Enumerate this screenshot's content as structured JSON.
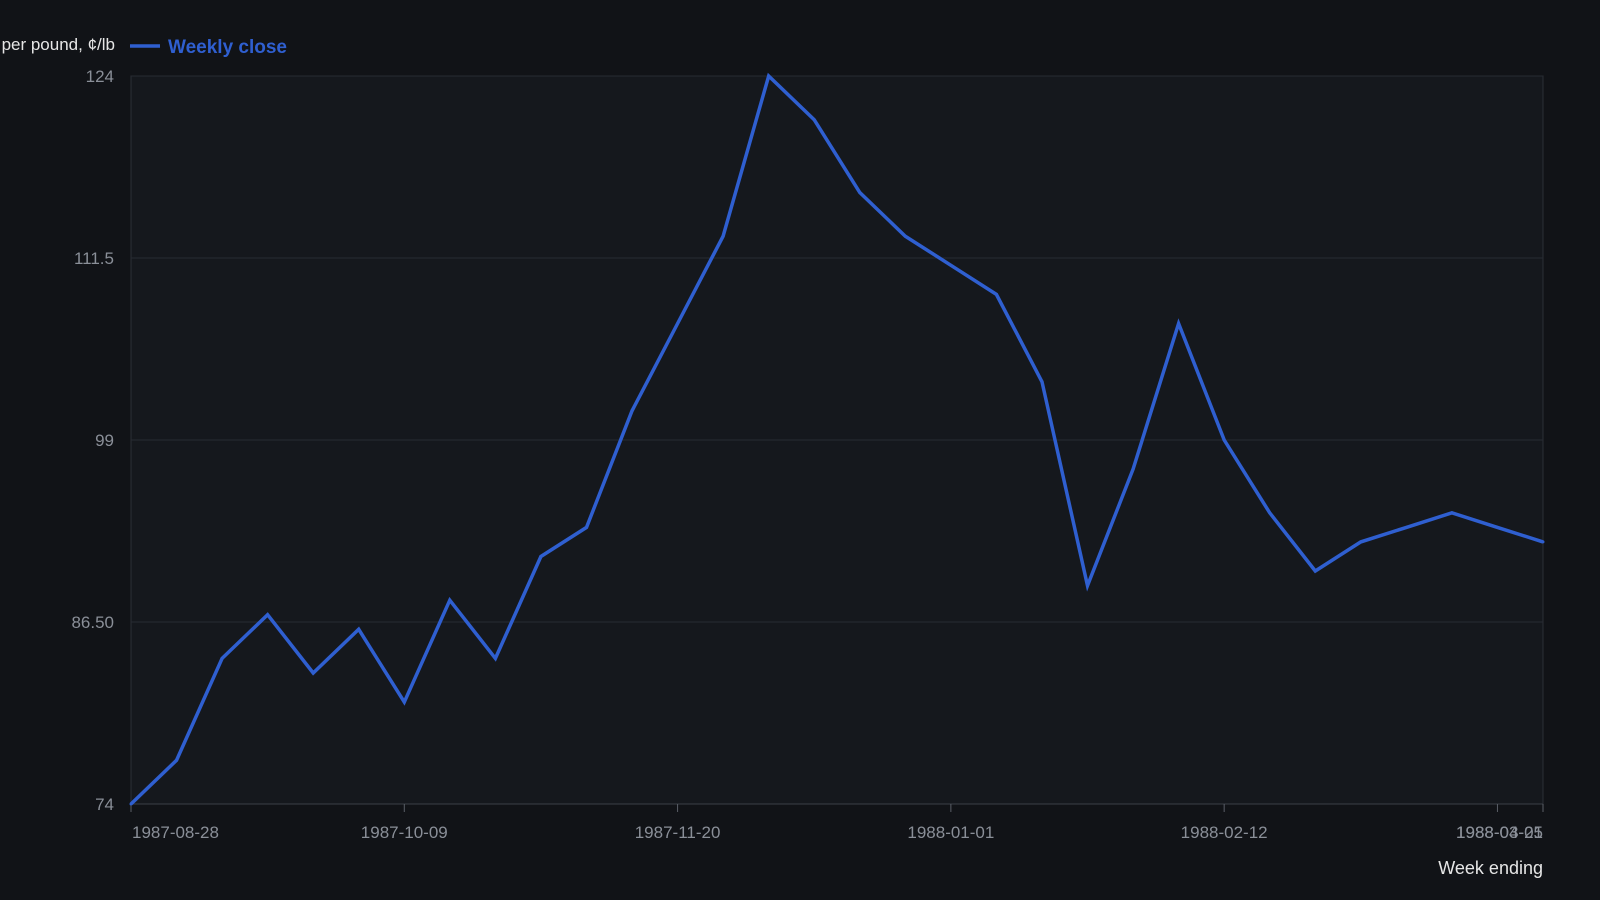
{
  "chart_data": {
    "type": "line",
    "ylabel": "Price per pound, ¢/lb",
    "xlabel": "Week ending",
    "ylim": [
      74,
      124
    ],
    "yticks": [
      "74",
      "86.50",
      "99",
      "111.5",
      "124"
    ],
    "xticks": [
      "1987-08-28",
      "1987-10-09",
      "1987-11-20",
      "1988-01-01",
      "1988-02-12",
      "1988-03-25",
      "1988-04-01"
    ],
    "grid": true,
    "legend": "top-left",
    "series": [
      {
        "name": "Weekly close",
        "color": "#2f5fd0",
        "x": [
          "1987-08-28",
          "1987-09-04",
          "1987-09-11",
          "1987-09-18",
          "1987-09-25",
          "1987-10-02",
          "1987-10-09",
          "1987-10-16",
          "1987-10-23",
          "1987-10-30",
          "1987-11-06",
          "1987-11-13",
          "1987-11-20",
          "1987-11-27",
          "1987-12-04",
          "1987-12-11",
          "1987-12-18",
          "1987-12-25",
          "1988-01-01",
          "1988-01-08",
          "1988-01-15",
          "1988-01-22",
          "1988-01-29",
          "1988-02-05",
          "1988-02-12",
          "1988-02-19",
          "1988-02-26",
          "1988-03-04",
          "1988-03-11",
          "1988-03-18",
          "1988-03-25",
          "1988-04-01"
        ],
        "values": [
          74.0,
          77.0,
          84.0,
          87.0,
          83.0,
          86.0,
          81.0,
          88.0,
          84.0,
          91.0,
          93.0,
          101.0,
          107.0,
          113.0,
          124.0,
          121.0,
          116.0,
          113.0,
          111.0,
          109.0,
          103.0,
          89.0,
          97.0,
          107.0,
          99.0,
          94.0,
          90.0,
          92.0,
          93.0,
          94.0,
          93.0,
          92.0
        ]
      }
    ]
  }
}
